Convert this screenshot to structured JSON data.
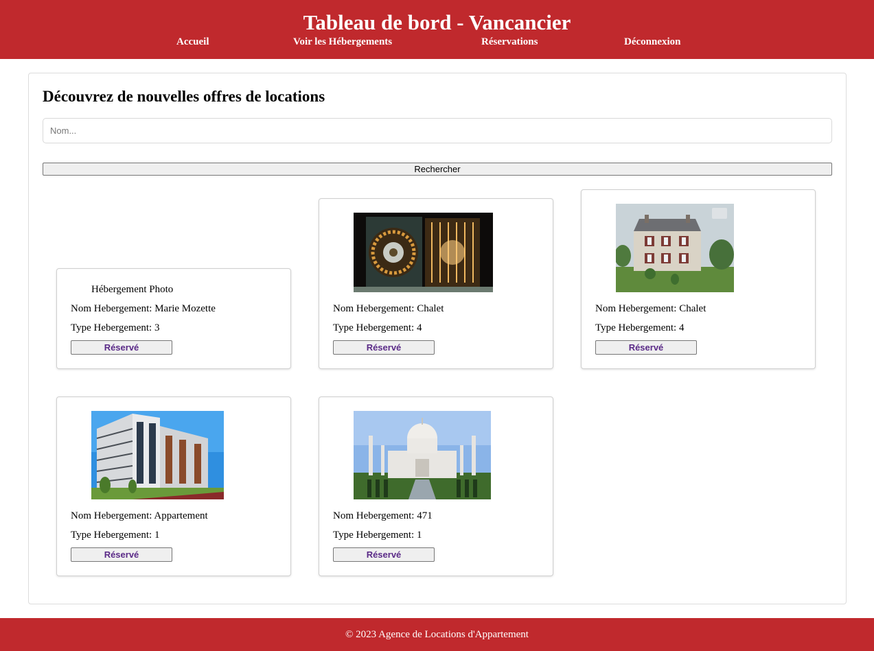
{
  "header": {
    "title": "Tableau de bord - Vancancier",
    "nav": [
      "Accueil",
      "Voir les Hébergements",
      "Réservations",
      "Déconnexion"
    ]
  },
  "main": {
    "heading": "Découvrez de nouvelles offres de locations",
    "search": {
      "placeholder": "Nom...",
      "value": ""
    },
    "search_button": "Rechercher",
    "labels": {
      "name_prefix": "Nom Hebergement: ",
      "type_prefix": "Type Hebergement: "
    },
    "broken_image_alt": "Hébergement Photo",
    "cards": [
      {
        "name": "Marie Mozette",
        "type": "3",
        "button": "Réservé",
        "image": "broken-image"
      },
      {
        "name": "Chalet",
        "type": "4",
        "button": "Réservé",
        "image": "bank-vault-photo"
      },
      {
        "name": "Chalet",
        "type": "4",
        "button": "Réservé",
        "image": "country-house-photo"
      },
      {
        "name": "Appartement",
        "type": "1",
        "button": "Réservé",
        "image": "apartment-building-photo"
      },
      {
        "name": "471",
        "type": "1",
        "button": "Réservé",
        "image": "taj-mahal-photo"
      }
    ]
  },
  "footer": {
    "text": "© 2023 Agence de Locations d'Appartement"
  },
  "colors": {
    "brand_red": "#c0292d",
    "button_text": "#5a2a87"
  }
}
